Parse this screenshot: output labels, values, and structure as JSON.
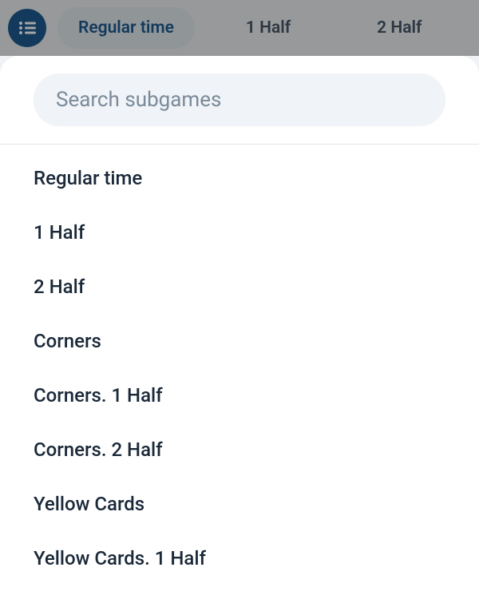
{
  "tabs": {
    "active": "Regular time",
    "items": [
      "Regular time",
      "1 Half",
      "2 Half"
    ]
  },
  "search": {
    "placeholder": "Search subgames",
    "value": ""
  },
  "subgames": [
    "Regular time",
    "1 Half",
    "2 Half",
    "Corners",
    "Corners. 1 Half",
    "Corners. 2 Half",
    "Yellow Cards",
    "Yellow Cards. 1 Half"
  ],
  "colors": {
    "primary": "#1e5a8e",
    "text": "#1a2838"
  }
}
